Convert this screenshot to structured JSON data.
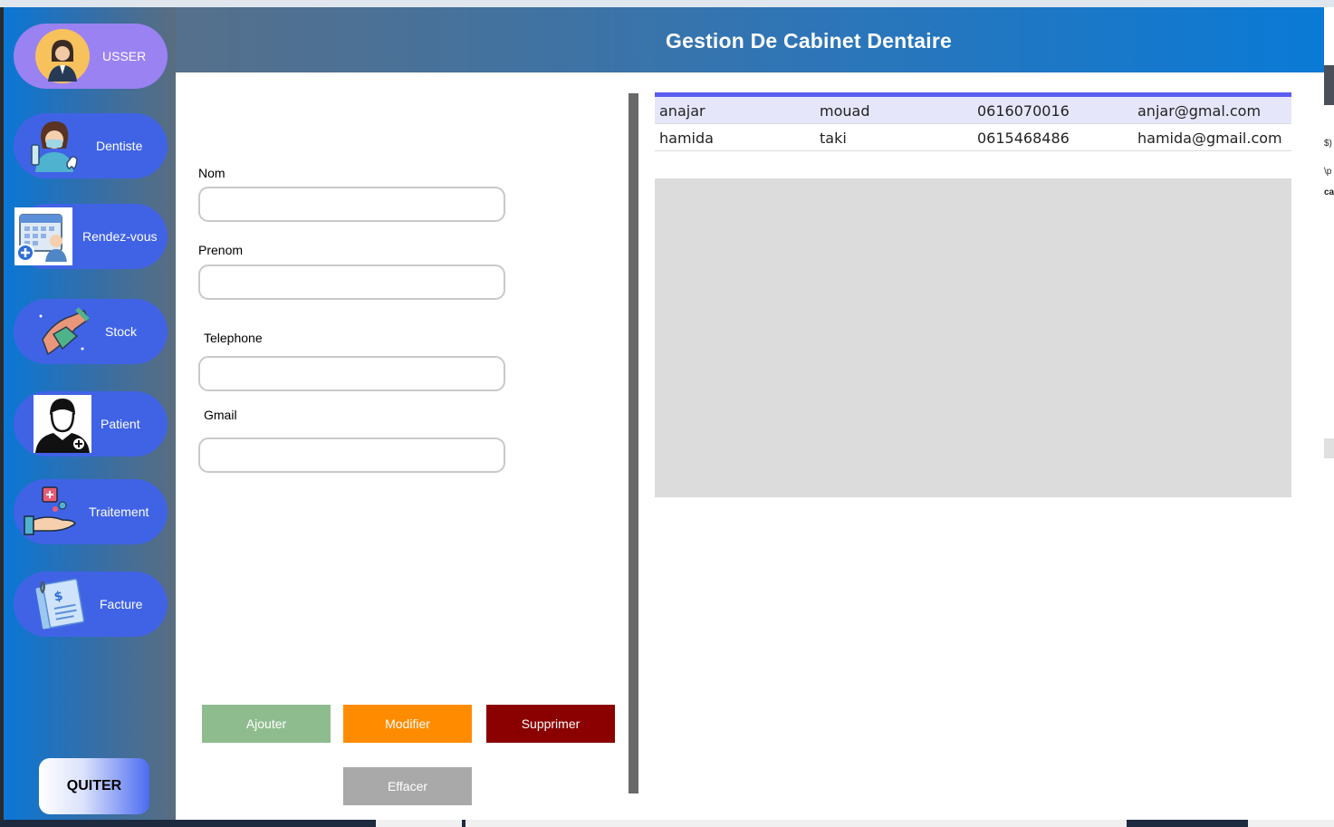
{
  "window": {
    "title": "Gestion De Cabinet Dentaire"
  },
  "sidebar": {
    "user": {
      "label": "USSER",
      "icon": "user-avatar-icon"
    },
    "items": [
      {
        "label": "Dentiste",
        "icon": "dentist-icon"
      },
      {
        "label": "Rendez-vous",
        "icon": "calendar-icon"
      },
      {
        "label": "Stock",
        "icon": "stock-icon"
      },
      {
        "label": "Patient",
        "icon": "patient-icon"
      },
      {
        "label": "Traitement",
        "icon": "treatment-icon"
      },
      {
        "label": "Facture",
        "icon": "invoice-icon"
      }
    ],
    "quit_label": "QUITER"
  },
  "form": {
    "nom": {
      "label": "Nom",
      "value": ""
    },
    "prenom": {
      "label": "Prenom",
      "value": ""
    },
    "telephone": {
      "label": "Telephone",
      "value": ""
    },
    "gmail": {
      "label": "Gmail",
      "value": ""
    }
  },
  "buttons": {
    "add": "Ajouter",
    "modify": "Modifier",
    "delete": "Supprimer",
    "clear": "Effacer"
  },
  "colors": {
    "add": "#8fbc8f",
    "modify": "#ff8c00",
    "delete": "#8b0000",
    "clear": "#a9a9a9",
    "pill": "#4063e6",
    "grid_header": "#5b5cf0"
  },
  "table": {
    "rows": [
      [
        "anajar",
        "mouad",
        "0616070016",
        "anjar@gmal.com"
      ],
      [
        "hamida",
        "taki",
        "0615468486",
        "hamida@gmail.com"
      ]
    ]
  },
  "desktop_fragments": [
    "$)",
    "\\p",
    "ca"
  ]
}
